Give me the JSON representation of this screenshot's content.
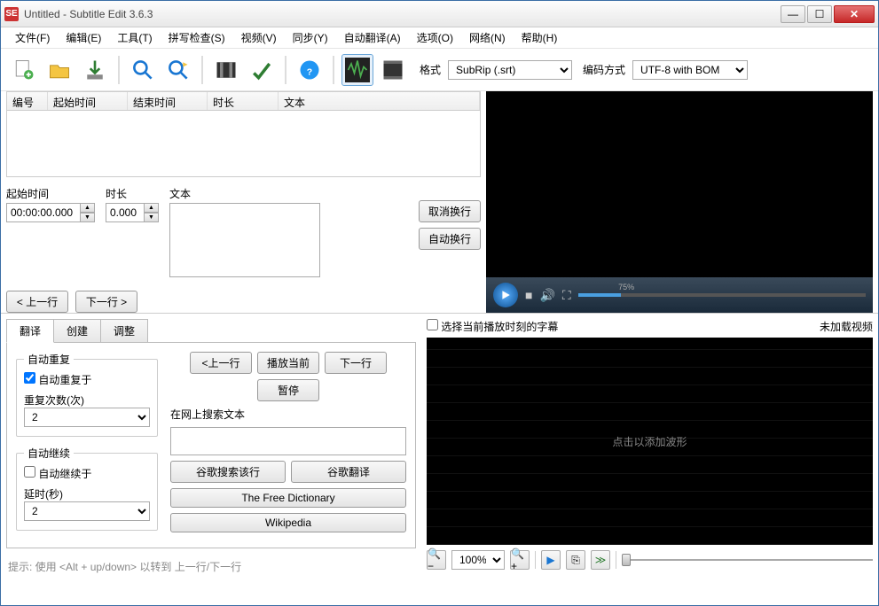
{
  "title": "Untitled - Subtitle Edit 3.6.3",
  "app_icon": "SE",
  "menu": [
    "文件(F)",
    "编辑(E)",
    "工具(T)",
    "拼写检查(S)",
    "视频(V)",
    "同步(Y)",
    "自动翻译(A)",
    "选项(O)",
    "网络(N)",
    "帮助(H)"
  ],
  "toolbar": {
    "format_label": "格式",
    "format_value": "SubRip (.srt)",
    "encoding_label": "编码方式",
    "encoding_value": "UTF-8 with BOM"
  },
  "grid_headers": {
    "num": "编号",
    "start": "起始时间",
    "end": "结束时间",
    "dur": "时长",
    "text": "文本"
  },
  "edit": {
    "start_label": "起始时间",
    "start_value": "00:00:00.000",
    "dur_label": "时长",
    "dur_value": "0.000",
    "text_label": "文本",
    "unbreak": "取消换行",
    "autobreak": "自动换行",
    "prev": "< 上一行",
    "next": "下一行 >"
  },
  "video": {
    "progress_pct": "75%"
  },
  "tabs": {
    "translate": "翻译",
    "create": "创建",
    "adjust": "调整"
  },
  "auto_repeat": {
    "group": "自动重复",
    "on": "自动重复于",
    "count_label": "重复次数(次)",
    "count_value": "2"
  },
  "auto_continue": {
    "group": "自动继续",
    "on": "自动继续于",
    "delay_label": "延时(秒)",
    "delay_value": "2"
  },
  "search": {
    "prev": "<上一行",
    "play": "播放当前",
    "next": "下一行",
    "pause": "暂停",
    "label": "在网上搜索文本",
    "google_line": "谷歌搜索该行",
    "google_translate": "谷歌翻译",
    "tfd": "The Free Dictionary",
    "wiki": "Wikipedia"
  },
  "hint": "提示: 使用 <Alt + up/down> 以转到 上一行/下一行",
  "wave": {
    "checkbox": "选择当前播放时刻的字幕",
    "no_video": "未加载视频",
    "placeholder": "点击以添加波形",
    "zoom": "100%"
  }
}
